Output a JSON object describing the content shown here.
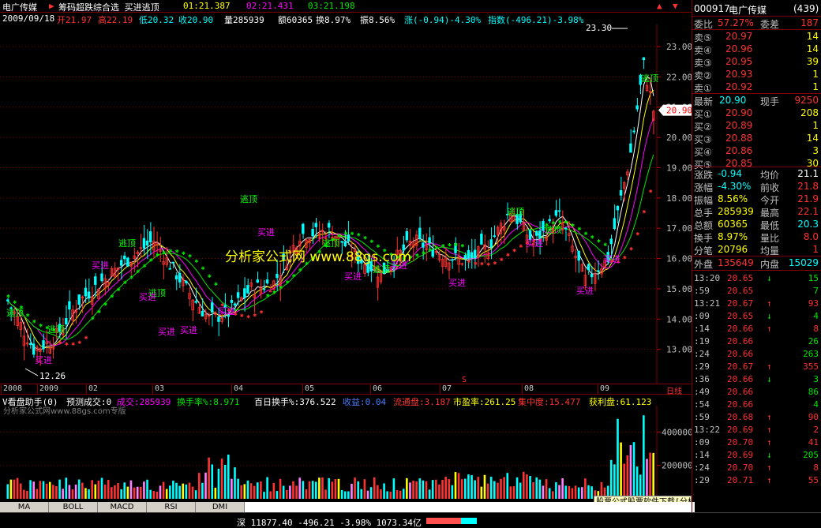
{
  "colors": {
    "up": "#ff3232",
    "down": "#00ffff",
    "ma1": "#ffffff",
    "ma2": "#ffff00",
    "ma3": "#ff00ff",
    "signal_green": "#00e600",
    "signal_red": "#ff3232"
  },
  "title": {
    "stock_name": "电广传媒",
    "indicator": "筹码超跌综合选 买进逃顶",
    "o1": "01:21.387",
    "o2": "02:21.431",
    "o3": "03:21.198"
  },
  "info": {
    "date": "2009/09/18",
    "open": "开21.97",
    "high": "高22.19",
    "low": "低20.32",
    "close": "收20.90",
    "volume": "量285939",
    "amount": "额60365",
    "turnover": "换8.97%",
    "amplitude": "振8.56%",
    "change": "涨(-0.94)-4.30%",
    "index": "指数(-496.21)-3.98%"
  },
  "price_axis": [
    "23.00",
    "22.00",
    "21.00",
    "20.00",
    "19.00",
    "18.00",
    "17.00",
    "16.00",
    "15.00",
    "14.00",
    "13.00"
  ],
  "current_price_tag": "20.90",
  "chart_labels": {
    "max_label": "23.30",
    "min_label": "12.26",
    "watermark": "分析家公式网 www.88gs.com",
    "escape": "逃顶",
    "buy": "买进",
    "s_marker": "S"
  },
  "chart_data": {
    "type": "candlestick",
    "x_months": [
      "2008",
      "2009",
      "02",
      "03",
      "04",
      "05",
      "06",
      "07",
      "08",
      "09"
    ],
    "period": "日线",
    "price_range": [
      12.26,
      23.3
    ],
    "last_close": 20.9
  },
  "month_ticks": [
    "2008",
    "2009",
    "02",
    "03",
    "04",
    "05",
    "06",
    "07",
    "08",
    "09"
  ],
  "period_label": "日线",
  "subinfo": {
    "title": "V看盘助手(0)",
    "forecast": "预测成交:0",
    "vol": "成交:285939",
    "turnover": "换手率%:8.971",
    "hundred_day": "百日换手%:376.522",
    "yield": "收益:0.04",
    "float": "流通盘:3.187",
    "pe": "市盈率:261.25",
    "concentration": "集中度:15.477",
    "profit": "获利盘:61.123"
  },
  "sub_watermark": "分析家公式网www.88gs.com专版",
  "vol_axis": [
    "400000",
    "200000"
  ],
  "tabs": [
    "MA",
    "BOLL",
    "MACD",
    "RSI",
    "DMI"
  ],
  "ad": "股票公式股票软件下载[分析家公式网www.88gs.com]",
  "bottom": {
    "index": "深 11877.40 -496.21 -3.98% 1073.34亿"
  },
  "panel": {
    "code": "000917",
    "name": "电广传媒",
    "count": "(439)",
    "weibi_label": "委比",
    "weibi": "57.27%",
    "weicha_label": "委差",
    "weicha": "187",
    "sells": [
      {
        "l": "卖⑤",
        "p": "20.97",
        "v": "14"
      },
      {
        "l": "卖④",
        "p": "20.96",
        "v": "14"
      },
      {
        "l": "卖③",
        "p": "20.95",
        "v": "39"
      },
      {
        "l": "卖②",
        "p": "20.93",
        "v": "1"
      },
      {
        "l": "卖①",
        "p": "20.92",
        "v": "1"
      }
    ],
    "latest_label": "最新",
    "latest": "20.90",
    "cur_label": "现手",
    "cur": "9250",
    "buys": [
      {
        "l": "买①",
        "p": "20.90",
        "v": "208"
      },
      {
        "l": "买②",
        "p": "20.89",
        "v": "1"
      },
      {
        "l": "买③",
        "p": "20.88",
        "v": "14"
      },
      {
        "l": "买④",
        "p": "20.86",
        "v": "3"
      },
      {
        "l": "买⑤",
        "p": "20.85",
        "v": "30"
      }
    ],
    "stats": [
      {
        "a": "涨跌",
        "av": "-0.94",
        "b": "均价",
        "bv": "21.1"
      },
      {
        "a": "涨幅",
        "av": "-4.30%",
        "b": "前收",
        "bv": "21.8"
      },
      {
        "a": "振幅",
        "av": "8.56%",
        "b": "今开",
        "bv": "21.9"
      },
      {
        "a": "总手",
        "av": "285939",
        "b": "最高",
        "bv": "22.1"
      },
      {
        "a": "总额",
        "av": "60365",
        "b": "最低",
        "bv": "20.3"
      },
      {
        "a": "换手",
        "av": "8.97%",
        "b": "量比",
        "bv": "8.0"
      },
      {
        "a": "分笔",
        "av": "20796",
        "b": "均量",
        "bv": "1"
      }
    ],
    "outer_label": "外盘",
    "outer": "135649",
    "inner_label": "内盘",
    "inner": "15029",
    "ticks": [
      {
        "t": "13:20",
        "p": "20.65",
        "d": "↓",
        "v": "15"
      },
      {
        "t": ":59",
        "p": "20.65",
        "d": "",
        "v": "7"
      },
      {
        "t": "13:21",
        "p": "20.67",
        "d": "↑",
        "v": "93"
      },
      {
        "t": ":09",
        "p": "20.65",
        "d": "↓",
        "v": "4"
      },
      {
        "t": ":14",
        "p": "20.66",
        "d": "↑",
        "v": "8"
      },
      {
        "t": ":19",
        "p": "20.66",
        "d": "",
        "v": "26"
      },
      {
        "t": ":24",
        "p": "20.66",
        "d": "",
        "v": "263"
      },
      {
        "t": ":29",
        "p": "20.67",
        "d": "↑",
        "v": "355"
      },
      {
        "t": ":36",
        "p": "20.66",
        "d": "↓",
        "v": "3"
      },
      {
        "t": ":49",
        "p": "20.66",
        "d": "",
        "v": "86"
      },
      {
        "t": ":54",
        "p": "20.66",
        "d": "",
        "v": "4"
      },
      {
        "t": ":59",
        "p": "20.68",
        "d": "↑",
        "v": "90"
      },
      {
        "t": "13:22",
        "p": "20.69",
        "d": "↑",
        "v": "2"
      },
      {
        "t": ":09",
        "p": "20.70",
        "d": "↑",
        "v": "41"
      },
      {
        "t": ":14",
        "p": "20.69",
        "d": "↓",
        "v": "205"
      },
      {
        "t": ":24",
        "p": "20.70",
        "d": "↑",
        "v": "8"
      },
      {
        "t": ":29",
        "p": "20.71",
        "d": "↑",
        "v": "55"
      }
    ]
  }
}
